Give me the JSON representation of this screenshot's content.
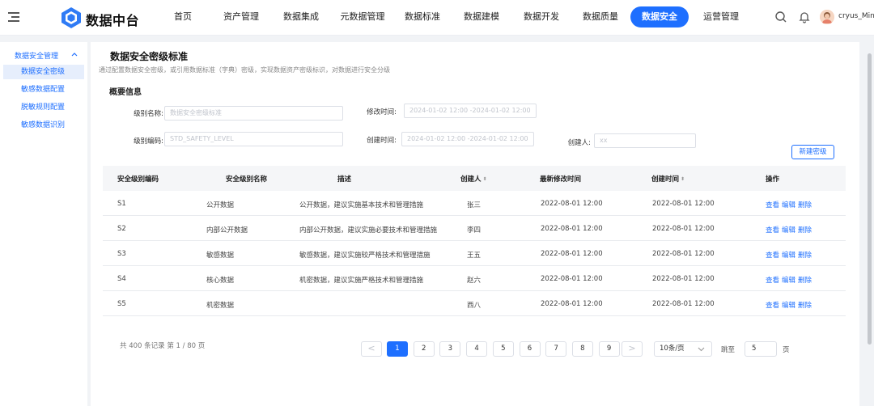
{
  "app": {
    "title": "数据中台"
  },
  "nav": {
    "items": [
      "首页",
      "资产管理",
      "数据集成",
      "元数据管理",
      "数据标准",
      "数据建模",
      "数据开发",
      "数据质量",
      "数据安全",
      "运营管理"
    ],
    "active_index": 8
  },
  "user": {
    "name": "cryus_Mind"
  },
  "sidebar": {
    "group_label": "数据安全管理",
    "items": [
      "数据安全密级",
      "敏感数据配置",
      "脱敏规则配置",
      "敏感数据识别"
    ],
    "active_index": 0
  },
  "page": {
    "title": "数据安全密级标准",
    "description": "通过配置数据安全密级，或引用数据标准（字典）密级，实现数据资产密级标识，对数据进行安全分级"
  },
  "filters": {
    "section_title": "概要信息",
    "level_name": {
      "label": "级别名称:",
      "placeholder": "数据安全密级标准"
    },
    "level_code": {
      "label": "级别编码:",
      "placeholder": "STD_SAFETY_LEVEL"
    },
    "modified_time": {
      "label": "修改时间:",
      "placeholder": "2024-01-02 12:00 -2024-01-02 12:00"
    },
    "created_time": {
      "label": "创建时间:",
      "placeholder": "2024-01-02 12:00 -2024-01-02 12:00"
    },
    "creator": {
      "label": "创建人:",
      "placeholder": "xx"
    },
    "new_button": "新建密级"
  },
  "table": {
    "columns": [
      "安全级别编码",
      "安全级别名称",
      "描述",
      "创建人",
      "最新修改时间",
      "创建时间",
      "操作"
    ],
    "sort_glyph": "⬍",
    "actions": [
      "查看",
      "编辑",
      "删除"
    ],
    "rows": [
      {
        "code": "S1",
        "name": "公开数据",
        "desc": "公开数据，建议实施基本技术和管理措施",
        "creator": "张三",
        "modified": "2022-08-01 12:00",
        "created": "2022-08-01 12:00"
      },
      {
        "code": "S2",
        "name": "内部公开数据",
        "desc": "内部公开数据，建议实施必要技术和管理措施",
        "creator": "李四",
        "modified": "2022-08-01 12:00",
        "created": "2022-08-01 12:00"
      },
      {
        "code": "S3",
        "name": "敏感数据",
        "desc": "敏感数据，建议实施较严格技术和管理措施",
        "creator": "王五",
        "modified": "2022-08-01 12:00",
        "created": "2022-08-01 12:00"
      },
      {
        "code": "S4",
        "name": "核心数据",
        "desc": "机密数据，建议实施严格技术和管理措施",
        "creator": "赵六",
        "modified": "2022-08-01 12:00",
        "created": "2022-08-01 12:00"
      },
      {
        "code": "S5",
        "name": "机密数据",
        "desc": "",
        "creator": "西八",
        "modified": "2022-08-01 12:00",
        "created": "2022-08-01 12:00"
      }
    ]
  },
  "pagination": {
    "total_text": "共 400 条记录 第 1 / 80 页",
    "prev": "<",
    "next": ">",
    "pages": [
      "1",
      "2",
      "3",
      "4",
      "5",
      "6",
      "7",
      "8",
      "9"
    ],
    "current_page": "1",
    "page_size": "10条/页",
    "jump_label": "跳至",
    "jump_value": "5",
    "jump_suffix": "页"
  },
  "colors": {
    "accent": "#1e6fff",
    "background": "#f1f3f6"
  }
}
